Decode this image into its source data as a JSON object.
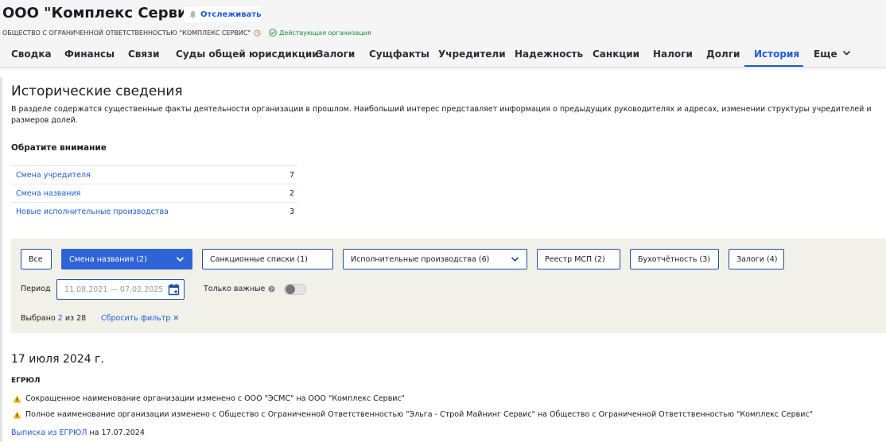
{
  "header": {
    "company_name": "ООО \"Комплекс Сервис\"",
    "track_label": "Отслеживать",
    "full_name": "ОБЩЕСТВО С ОГРАНИЧЕННОЙ ОТВЕТСТВЕННОСТЬЮ \"КОМПЛЕКС СЕРВИС\"",
    "status": "Действующая организация"
  },
  "tabs": [
    {
      "label": "Сводка"
    },
    {
      "label": "Финансы"
    },
    {
      "label": "Связи"
    },
    {
      "label": "Суды общей юрисдикции"
    },
    {
      "label": "Залоги"
    },
    {
      "label": "Сущфакты"
    },
    {
      "label": "Учредители"
    },
    {
      "label": "Надежность"
    },
    {
      "label": "Санкции"
    },
    {
      "label": "Налоги"
    },
    {
      "label": "Долги"
    },
    {
      "label": "История",
      "active": true
    },
    {
      "label": "Еще"
    }
  ],
  "main": {
    "title": "Исторические сведения",
    "description": "В разделе содержатся существенные факты деятельности организации в прошлом. Наибольший интерес представляет информация о предыдущих руководителях и адресах, изменении структуры учредителей и размеров долей.",
    "attention_title": "Обратите внимание",
    "attention_items": [
      {
        "label": "Смена учредителя",
        "count": "7"
      },
      {
        "label": "Смена названия",
        "count": "2"
      },
      {
        "label": "Новые исполнительные производства",
        "count": "3"
      }
    ]
  },
  "filters": {
    "buttons": [
      {
        "label": "Все"
      },
      {
        "label": "Смена названия (2)",
        "selected": true
      },
      {
        "label": "Санкционные списки (1)"
      },
      {
        "label": "Исполнительные производства (6)"
      },
      {
        "label": "Реестр МСП (2)"
      },
      {
        "label": "Бухотчётность (3)"
      },
      {
        "label": "Залоги (4)"
      }
    ],
    "period_label": "Период",
    "period_value": "11.08.2021 — 07.02.2025",
    "important_label": "Только важные",
    "important_on": false,
    "selected_prefix": "Выбрано",
    "selected_count": "2",
    "selected_suffix": "из 28",
    "reset_label": "Сбросить фильтр ✕"
  },
  "events": {
    "date": "17 июля 2024 г.",
    "source": "ЕГРЮЛ",
    "items": [
      "Сокращенное наименование организации изменено с ООО \"ЭСМС\" на ООО \"Комплекс Сервис\"",
      "Полное наименование организации изменено с Общество с Ограниченной Ответственностью \"Эльга - Строй Майнинг Сервис\" на Общество с Ограниченной Ответственностью \"Комплекс Сервис\""
    ],
    "extract_link": "Выписка из ЕГРЮЛ",
    "extract_date": "на 17.07.2024"
  },
  "colors": {
    "accent": "#1e5bd8",
    "status_green": "#1f8a3a",
    "warning": "#f2b705",
    "filter_bg": "#f1f1ea"
  }
}
